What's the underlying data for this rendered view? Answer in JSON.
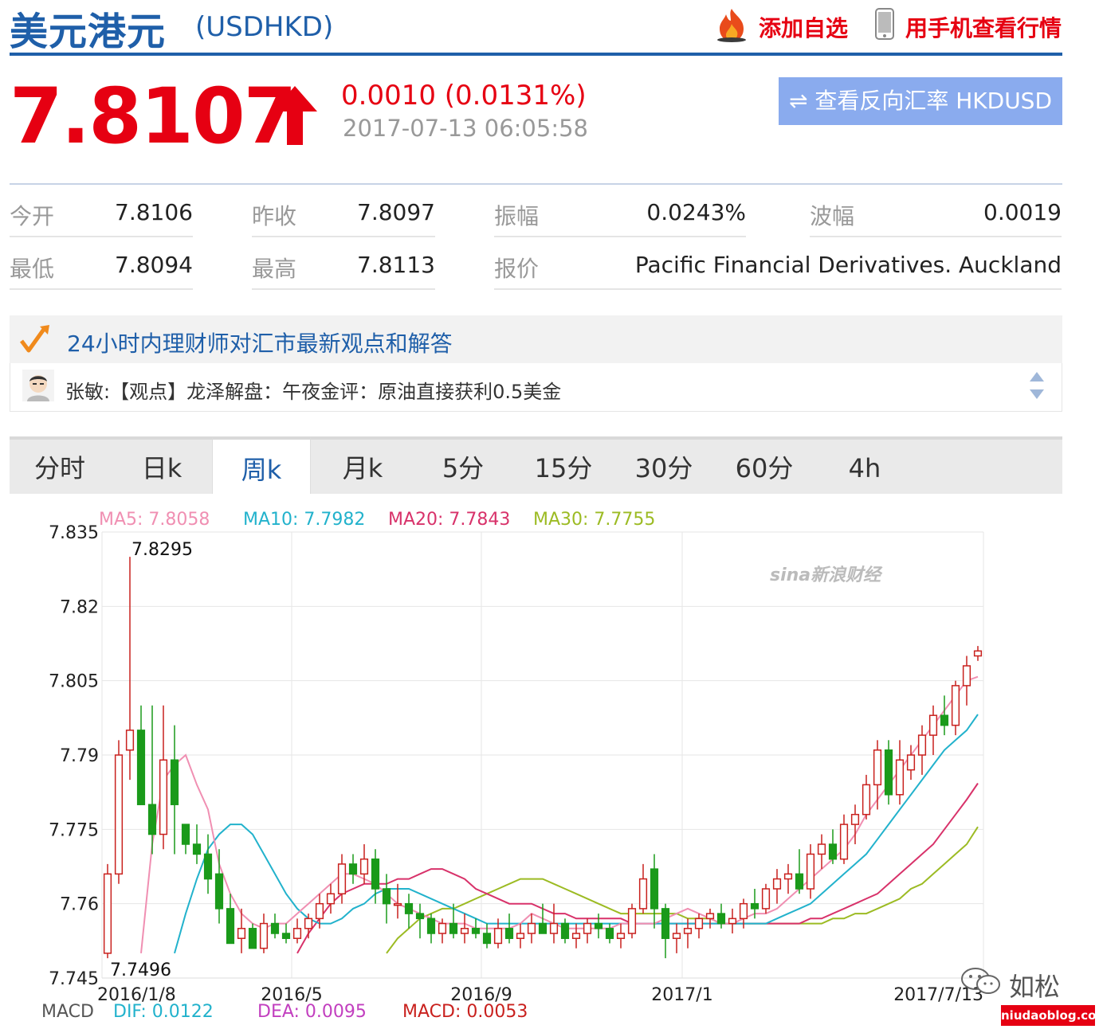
{
  "header": {
    "title": "美元港元",
    "code": "(USDHKD)",
    "add_watchlist": "添加自选",
    "mobile_view": "用手机查看行情"
  },
  "price": {
    "last": "7.8107",
    "change": "0.0010 (0.0131%)",
    "updated": "2017-07-13 06:05:58",
    "reverse_button": "⇌ 查看反向汇率 HKDUSD"
  },
  "quote": {
    "open_label": "今开",
    "open": "7.8106",
    "prev_close_label": "昨收",
    "prev_close": "7.8097",
    "amplitude_label": "振幅",
    "amplitude": "0.0243%",
    "range_label": "波幅",
    "range": "0.0019",
    "low_label": "最低",
    "low": "7.8094",
    "high_label": "最高",
    "high": "7.8113",
    "source_label": "报价",
    "source": "Pacific Financial Derivatives. Auckland"
  },
  "news": {
    "title": "24小时内理财师对汇市最新观点和解答",
    "item": "张敏:【观点】龙泽解盘：午夜金评：原油直接获利0.5美金"
  },
  "tabs": [
    "分时",
    "日k",
    "周k",
    "月k",
    "5分",
    "15分",
    "30分",
    "60分",
    "4h"
  ],
  "active_tab": "周k",
  "ma_legend": {
    "ma5": "MA5: 7.8058",
    "ma10": "MA10: 7.7982",
    "ma20": "MA20: 7.7843",
    "ma30": "MA30: 7.7755"
  },
  "macd_legend": {
    "label": "MACD",
    "dif": "DIF: 0.0122",
    "dea": "DEA: 0.0095",
    "macd": "MACD: 0.0053"
  },
  "watermark": "sina新浪财经",
  "wechat": "如松",
  "site": "niudaoblog.com",
  "colors": {
    "up": "#c9211e",
    "down": "#1a9a1a",
    "ma5": "#f08fb2",
    "ma10": "#22b2cc",
    "ma20": "#d8326a",
    "ma30": "#9cbb23",
    "accent": "#1f5fa9"
  },
  "chart_data": {
    "type": "candlestick",
    "y_ticks": [
      "7.835",
      "7.82",
      "7.805",
      "7.79",
      "7.775",
      "7.76",
      "7.745"
    ],
    "ylim": [
      7.745,
      7.835
    ],
    "x_ticks": [
      "2016/1/8",
      "2016/5",
      "2016/9",
      "2017/1",
      "2017/7/13"
    ],
    "annotations": {
      "max_label": "7.8295",
      "min_label": "7.7496"
    },
    "candles": [
      {
        "o": 7.75,
        "h": 7.768,
        "l": 7.749,
        "c": 7.766
      },
      {
        "o": 7.766,
        "h": 7.793,
        "l": 7.764,
        "c": 7.79
      },
      {
        "o": 7.791,
        "h": 7.83,
        "l": 7.785,
        "c": 7.795
      },
      {
        "o": 7.795,
        "h": 7.8,
        "l": 7.783,
        "c": 7.78
      },
      {
        "o": 7.78,
        "h": 7.8,
        "l": 7.77,
        "c": 7.774
      },
      {
        "o": 7.774,
        "h": 7.8,
        "l": 7.771,
        "c": 7.789
      },
      {
        "o": 7.789,
        "h": 7.796,
        "l": 7.77,
        "c": 7.78
      },
      {
        "o": 7.776,
        "h": 7.772,
        "l": 7.77,
        "c": 7.772
      },
      {
        "o": 7.772,
        "h": 7.776,
        "l": 7.768,
        "c": 7.77
      },
      {
        "o": 7.77,
        "h": 7.774,
        "l": 7.762,
        "c": 7.765
      },
      {
        "o": 7.766,
        "h": 7.771,
        "l": 7.756,
        "c": 7.759
      },
      {
        "o": 7.759,
        "h": 7.762,
        "l": 7.752,
        "c": 7.752
      },
      {
        "o": 7.753,
        "h": 7.759,
        "l": 7.75,
        "c": 7.755
      },
      {
        "o": 7.755,
        "h": 7.756,
        "l": 7.751,
        "c": 7.751
      },
      {
        "o": 7.751,
        "h": 7.758,
        "l": 7.75,
        "c": 7.756
      },
      {
        "o": 7.756,
        "h": 7.758,
        "l": 7.753,
        "c": 7.754
      },
      {
        "o": 7.754,
        "h": 7.756,
        "l": 7.752,
        "c": 7.753
      },
      {
        "o": 7.753,
        "h": 7.757,
        "l": 7.752,
        "c": 7.755
      },
      {
        "o": 7.755,
        "h": 7.758,
        "l": 7.753,
        "c": 7.757
      },
      {
        "o": 7.757,
        "h": 7.762,
        "l": 7.755,
        "c": 7.76
      },
      {
        "o": 7.76,
        "h": 7.764,
        "l": 7.758,
        "c": 7.762
      },
      {
        "o": 7.762,
        "h": 7.77,
        "l": 7.76,
        "c": 7.768
      },
      {
        "o": 7.768,
        "h": 7.77,
        "l": 7.764,
        "c": 7.766
      },
      {
        "o": 7.766,
        "h": 7.772,
        "l": 7.764,
        "c": 7.769
      },
      {
        "o": 7.769,
        "h": 7.771,
        "l": 7.76,
        "c": 7.763
      },
      {
        "o": 7.763,
        "h": 7.766,
        "l": 7.756,
        "c": 7.76
      },
      {
        "o": 7.76,
        "h": 7.764,
        "l": 7.757,
        "c": 7.76
      },
      {
        "o": 7.76,
        "h": 7.762,
        "l": 7.755,
        "c": 7.758
      },
      {
        "o": 7.758,
        "h": 7.76,
        "l": 7.753,
        "c": 7.757
      },
      {
        "o": 7.757,
        "h": 7.758,
        "l": 7.752,
        "c": 7.754
      },
      {
        "o": 7.754,
        "h": 7.757,
        "l": 7.752,
        "c": 7.756
      },
      {
        "o": 7.756,
        "h": 7.76,
        "l": 7.753,
        "c": 7.754
      },
      {
        "o": 7.754,
        "h": 7.758,
        "l": 7.752,
        "c": 7.755
      },
      {
        "o": 7.755,
        "h": 7.757,
        "l": 7.753,
        "c": 7.754
      },
      {
        "o": 7.754,
        "h": 7.756,
        "l": 7.751,
        "c": 7.752
      },
      {
        "o": 7.752,
        "h": 7.757,
        "l": 7.751,
        "c": 7.755
      },
      {
        "o": 7.755,
        "h": 7.758,
        "l": 7.752,
        "c": 7.753
      },
      {
        "o": 7.753,
        "h": 7.756,
        "l": 7.751,
        "c": 7.754
      },
      {
        "o": 7.754,
        "h": 7.758,
        "l": 7.752,
        "c": 7.756
      },
      {
        "o": 7.756,
        "h": 7.76,
        "l": 7.754,
        "c": 7.754
      },
      {
        "o": 7.754,
        "h": 7.76,
        "l": 7.752,
        "c": 7.756
      },
      {
        "o": 7.756,
        "h": 7.757,
        "l": 7.752,
        "c": 7.753
      },
      {
        "o": 7.753,
        "h": 7.756,
        "l": 7.751,
        "c": 7.754
      },
      {
        "o": 7.754,
        "h": 7.757,
        "l": 7.752,
        "c": 7.756
      },
      {
        "o": 7.756,
        "h": 7.758,
        "l": 7.753,
        "c": 7.755
      },
      {
        "o": 7.755,
        "h": 7.756,
        "l": 7.752,
        "c": 7.753
      },
      {
        "o": 7.753,
        "h": 7.756,
        "l": 7.751,
        "c": 7.754
      },
      {
        "o": 7.754,
        "h": 7.76,
        "l": 7.753,
        "c": 7.759
      },
      {
        "o": 7.759,
        "h": 7.768,
        "l": 7.758,
        "c": 7.765
      },
      {
        "o": 7.767,
        "h": 7.77,
        "l": 7.755,
        "c": 7.759
      },
      {
        "o": 7.759,
        "h": 7.76,
        "l": 7.749,
        "c": 7.753
      },
      {
        "o": 7.753,
        "h": 7.756,
        "l": 7.75,
        "c": 7.754
      },
      {
        "o": 7.754,
        "h": 7.757,
        "l": 7.751,
        "c": 7.755
      },
      {
        "o": 7.755,
        "h": 7.758,
        "l": 7.753,
        "c": 7.757
      },
      {
        "o": 7.757,
        "h": 7.759,
        "l": 7.755,
        "c": 7.758
      },
      {
        "o": 7.758,
        "h": 7.76,
        "l": 7.755,
        "c": 7.756
      },
      {
        "o": 7.756,
        "h": 7.759,
        "l": 7.754,
        "c": 7.757
      },
      {
        "o": 7.757,
        "h": 7.761,
        "l": 7.755,
        "c": 7.76
      },
      {
        "o": 7.76,
        "h": 7.763,
        "l": 7.757,
        "c": 7.759
      },
      {
        "o": 7.759,
        "h": 7.764,
        "l": 7.758,
        "c": 7.763
      },
      {
        "o": 7.763,
        "h": 7.767,
        "l": 7.76,
        "c": 7.765
      },
      {
        "o": 7.765,
        "h": 7.768,
        "l": 7.762,
        "c": 7.766
      },
      {
        "o": 7.766,
        "h": 7.771,
        "l": 7.762,
        "c": 7.763
      },
      {
        "o": 7.763,
        "h": 7.772,
        "l": 7.761,
        "c": 7.77
      },
      {
        "o": 7.77,
        "h": 7.774,
        "l": 7.767,
        "c": 7.772
      },
      {
        "o": 7.772,
        "h": 7.775,
        "l": 7.768,
        "c": 7.769
      },
      {
        "o": 7.769,
        "h": 7.778,
        "l": 7.768,
        "c": 7.776
      },
      {
        "o": 7.776,
        "h": 7.78,
        "l": 7.772,
        "c": 7.778
      },
      {
        "o": 7.778,
        "h": 7.786,
        "l": 7.777,
        "c": 7.784
      },
      {
        "o": 7.784,
        "h": 7.793,
        "l": 7.779,
        "c": 7.791
      },
      {
        "o": 7.791,
        "h": 7.793,
        "l": 7.78,
        "c": 7.782
      },
      {
        "o": 7.782,
        "h": 7.793,
        "l": 7.78,
        "c": 7.789
      },
      {
        "o": 7.787,
        "h": 7.792,
        "l": 7.785,
        "c": 7.79
      },
      {
        "o": 7.79,
        "h": 7.796,
        "l": 7.786,
        "c": 7.794
      },
      {
        "o": 7.794,
        "h": 7.8,
        "l": 7.79,
        "c": 7.798
      },
      {
        "o": 7.798,
        "h": 7.802,
        "l": 7.794,
        "c": 7.796
      },
      {
        "o": 7.796,
        "h": 7.805,
        "l": 7.794,
        "c": 7.804
      },
      {
        "o": 7.804,
        "h": 7.81,
        "l": 7.8,
        "c": 7.808
      },
      {
        "o": 7.81,
        "h": 7.812,
        "l": 7.809,
        "c": 7.811
      }
    ],
    "ma5": [
      7.75,
      7.772,
      7.785,
      7.788,
      7.79,
      7.784,
      7.779,
      7.768,
      7.762,
      7.758,
      7.756,
      7.755,
      7.756,
      7.756,
      7.758,
      7.76,
      7.762,
      7.764,
      7.766,
      7.766,
      7.765,
      7.764,
      7.762,
      7.76,
      7.759,
      7.758,
      7.757,
      7.756,
      7.756,
      7.756,
      7.755,
      7.755,
      7.755,
      7.755,
      7.756,
      7.758,
      7.757,
      7.756,
      7.755,
      7.755,
      7.755,
      7.755,
      7.755,
      7.756,
      7.756,
      7.756,
      7.756,
      7.757,
      7.758,
      7.759,
      7.758,
      7.757,
      7.756,
      7.756,
      7.757,
      7.758,
      7.758,
      7.759,
      7.761,
      7.763,
      7.765,
      7.767,
      7.769,
      7.771,
      7.774,
      7.778,
      7.781,
      7.784,
      7.787,
      7.79,
      7.793,
      7.796,
      7.799,
      7.802,
      7.805,
      7.8058
    ],
    "ma10": [
      7.75,
      7.758,
      7.765,
      7.771,
      7.774,
      7.776,
      7.776,
      7.774,
      7.77,
      7.766,
      7.762,
      7.759,
      7.757,
      7.756,
      7.756,
      7.757,
      7.759,
      7.76,
      7.762,
      7.763,
      7.763,
      7.763,
      7.762,
      7.761,
      7.76,
      7.759,
      7.758,
      7.757,
      7.756,
      7.756,
      7.756,
      7.756,
      7.756,
      7.756,
      7.756,
      7.756,
      7.756,
      7.756,
      7.756,
      7.756,
      7.756,
      7.756,
      7.756,
      7.756,
      7.756,
      7.756,
      7.756,
      7.756,
      7.756,
      7.756,
      7.756,
      7.756,
      7.756,
      7.756,
      7.757,
      7.758,
      7.759,
      7.76,
      7.762,
      7.764,
      7.766,
      7.768,
      7.77,
      7.773,
      7.776,
      7.779,
      7.782,
      7.785,
      7.788,
      7.791,
      7.793,
      7.795,
      7.7982
    ],
    "ma20": [
      7.75,
      7.754,
      7.757,
      7.76,
      7.762,
      7.763,
      7.764,
      7.764,
      7.764,
      7.765,
      7.765,
      7.766,
      7.767,
      7.767,
      7.766,
      7.765,
      7.763,
      7.762,
      7.761,
      7.76,
      7.76,
      7.76,
      7.759,
      7.758,
      7.758,
      7.757,
      7.757,
      7.757,
      7.757,
      7.757,
      7.756,
      7.756,
      7.756,
      7.756,
      7.756,
      7.756,
      7.756,
      7.756,
      7.756,
      7.756,
      7.756,
      7.756,
      7.756,
      7.756,
      7.756,
      7.756,
      7.757,
      7.757,
      7.758,
      7.759,
      7.76,
      7.761,
      7.762,
      7.764,
      7.766,
      7.768,
      7.77,
      7.772,
      7.775,
      7.778,
      7.781,
      7.7843
    ],
    "ma30": [
      7.75,
      7.753,
      7.755,
      7.757,
      7.758,
      7.759,
      7.759,
      7.76,
      7.761,
      7.762,
      7.763,
      7.764,
      7.765,
      7.765,
      7.765,
      7.764,
      7.763,
      7.762,
      7.761,
      7.76,
      7.759,
      7.758,
      7.758,
      7.758,
      7.758,
      7.758,
      7.758,
      7.757,
      7.757,
      7.757,
      7.756,
      7.756,
      7.756,
      7.756,
      7.756,
      7.756,
      7.756,
      7.756,
      7.756,
      7.756,
      7.757,
      7.757,
      7.758,
      7.758,
      7.759,
      7.76,
      7.761,
      7.763,
      7.764,
      7.766,
      7.768,
      7.77,
      7.772,
      7.7755
    ]
  }
}
